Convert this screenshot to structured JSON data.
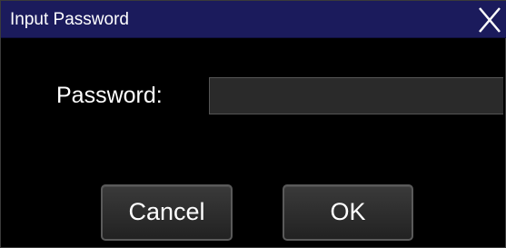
{
  "window": {
    "title": "Input Password",
    "close_icon": "close-icon"
  },
  "form": {
    "password_label": "Password:",
    "password_value": "",
    "password_placeholder": ""
  },
  "buttons": {
    "cancel_label": "Cancel",
    "ok_label": "OK"
  },
  "colors": {
    "titlebar": "#1b1b5c",
    "background": "#000000",
    "input_background": "#2a2a2a",
    "button_border": "#5a5a5a",
    "text": "#ffffff"
  }
}
